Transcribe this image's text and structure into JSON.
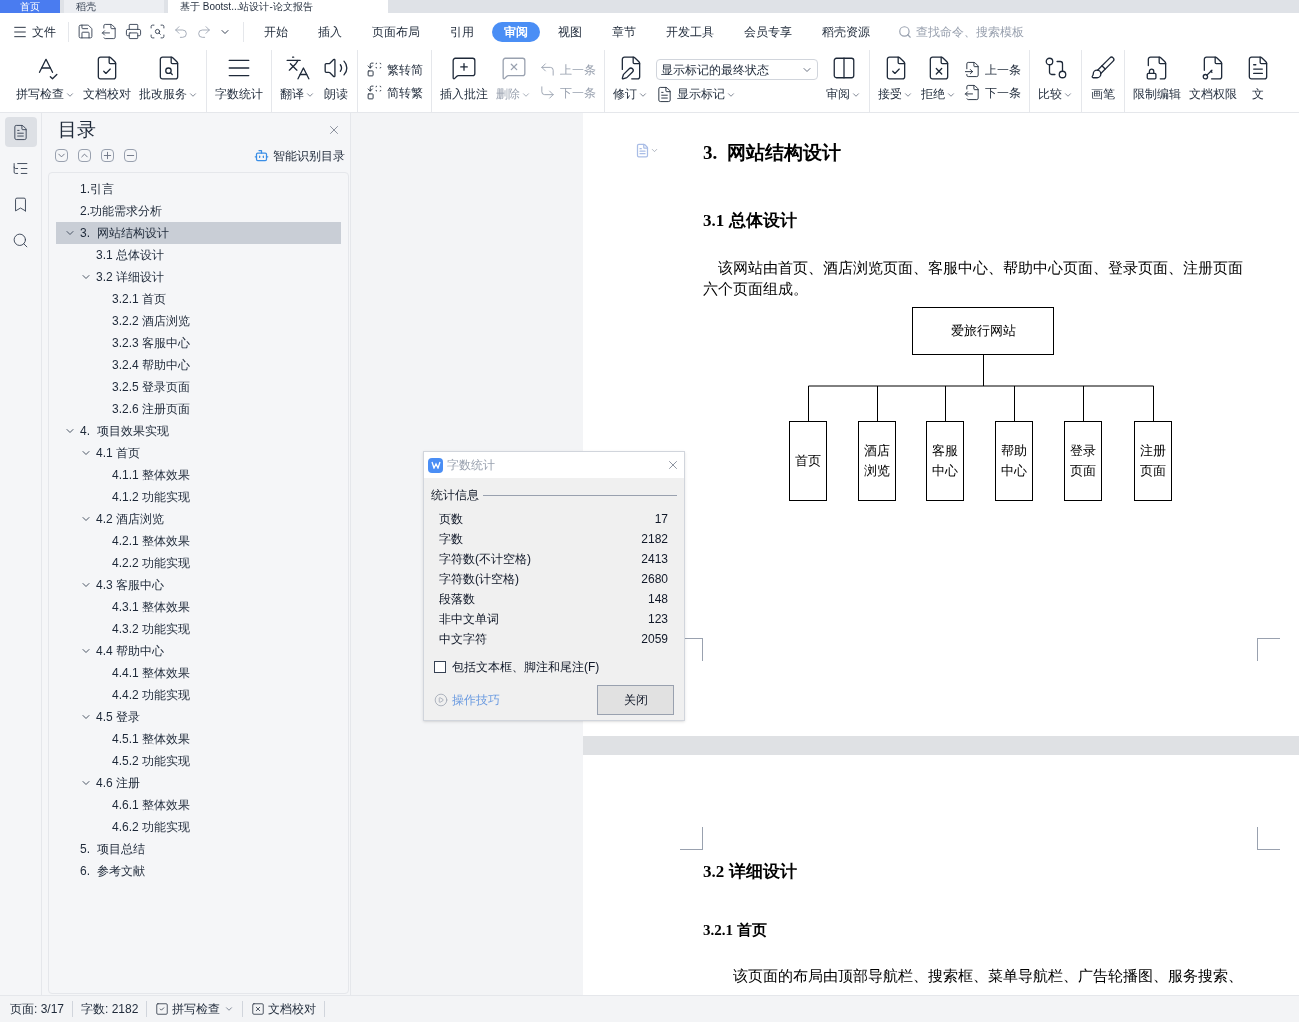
{
  "tab_strip": [
    {
      "label": "首页",
      "selected": false
    },
    {
      "label": "稻壳",
      "selected": false
    },
    {
      "label": "基于 Bootst...站设计-论文报告",
      "selected": true
    }
  ],
  "menu": {
    "file": "文件",
    "tabs": [
      {
        "label": "开始",
        "selected": false
      },
      {
        "label": "插入",
        "selected": false
      },
      {
        "label": "页面布局",
        "selected": false
      },
      {
        "label": "引用",
        "selected": false
      },
      {
        "label": "审阅",
        "selected": true
      },
      {
        "label": "视图",
        "selected": false
      },
      {
        "label": "章节",
        "selected": false
      },
      {
        "label": "开发工具",
        "selected": false
      },
      {
        "label": "会员专享",
        "selected": false
      },
      {
        "label": "稻壳资源",
        "selected": false
      }
    ],
    "search": {
      "placeholder": "查找命令、搜索模板"
    }
  },
  "ribbon": [
    {
      "items": [
        {
          "kind": "large",
          "label": "拼写检查",
          "dropdown": true,
          "disabled": false
        },
        {
          "kind": "large",
          "label": "文档校对",
          "dropdown": false,
          "disabled": false
        },
        {
          "kind": "large",
          "label": "批改服务",
          "dropdown": true,
          "disabled": false
        }
      ]
    },
    {
      "items": [
        {
          "kind": "large",
          "label": "字数统计",
          "dropdown": false,
          "disabled": false
        }
      ]
    },
    {
      "items": [
        {
          "kind": "large",
          "label": "翻译",
          "dropdown": true,
          "disabled": false
        },
        {
          "kind": "large",
          "label": "朗读",
          "dropdown": false,
          "disabled": false
        }
      ]
    },
    {
      "items": [
        {
          "kind": "stack",
          "rows": [
            {
              "kind": "button",
              "label": "繁转简",
              "dropdown": false,
              "disabled": false
            },
            {
              "kind": "button",
              "label": "简转繁",
              "dropdown": false,
              "disabled": false
            }
          ]
        }
      ]
    },
    {
      "items": [
        {
          "kind": "large",
          "label": "插入批注",
          "dropdown": false,
          "disabled": false
        },
        {
          "kind": "large",
          "label": "删除",
          "dropdown": true,
          "disabled": true
        },
        {
          "kind": "stack",
          "rows": [
            {
              "kind": "button",
              "label": "上一条",
              "dropdown": false,
              "disabled": true
            },
            {
              "kind": "button",
              "label": "下一条",
              "dropdown": false,
              "disabled": true
            }
          ]
        }
      ]
    },
    {
      "items": [
        {
          "kind": "large",
          "label": "修订",
          "dropdown": true,
          "disabled": false
        },
        {
          "kind": "stack",
          "rows": [
            {
              "kind": "select",
              "value": "显示标记的最终状态"
            },
            {
              "kind": "button",
              "label": "显示标记",
              "dropdown": true,
              "disabled": false
            }
          ]
        },
        {
          "kind": "large",
          "label": "审阅",
          "dropdown": true,
          "disabled": false
        }
      ]
    },
    {
      "items": [
        {
          "kind": "large",
          "label": "接受",
          "dropdown": true,
          "disabled": false
        },
        {
          "kind": "large",
          "label": "拒绝",
          "dropdown": true,
          "disabled": false
        },
        {
          "kind": "stack",
          "rows": [
            {
              "kind": "button",
              "label": "上一条",
              "dropdown": false,
              "disabled": false
            },
            {
              "kind": "button",
              "label": "下一条",
              "dropdown": false,
              "disabled": false
            }
          ]
        }
      ]
    },
    {
      "items": [
        {
          "kind": "large",
          "label": "比较",
          "dropdown": true,
          "disabled": false
        }
      ]
    },
    {
      "items": [
        {
          "kind": "large",
          "label": "画笔",
          "dropdown": false,
          "disabled": false
        }
      ]
    },
    {
      "items": [
        {
          "kind": "large",
          "label": "限制编辑",
          "dropdown": false,
          "disabled": false
        },
        {
          "kind": "large",
          "label": "文档权限",
          "dropdown": false,
          "disabled": false
        },
        {
          "kind": "large",
          "label": "文",
          "dropdown": false,
          "disabled": false
        }
      ]
    }
  ],
  "rail": [
    {
      "selected": true
    },
    {
      "selected": false
    },
    {
      "selected": false
    },
    {
      "selected": false
    }
  ],
  "toc": {
    "title": "目录",
    "smart_button": "智能识别目录",
    "items": [
      {
        "label": "1.引言",
        "selected": false
      },
      {
        "label": "2.功能需求分析",
        "selected": false
      },
      {
        "label": "3.  网站结构设计",
        "selected": true,
        "expanded": true,
        "children": [
          {
            "label": "3.1 总体设计",
            "selected": false
          },
          {
            "label": "3.2 详细设计",
            "selected": false,
            "expanded": true,
            "children": [
              {
                "label": "3.2.1 首页",
                "selected": false
              },
              {
                "label": "3.2.2 酒店浏览",
                "selected": false
              },
              {
                "label": "3.2.3 客服中心",
                "selected": false
              },
              {
                "label": "3.2.4 帮助中心",
                "selected": false
              },
              {
                "label": "3.2.5 登录页面",
                "selected": false
              },
              {
                "label": "3.2.6 注册页面",
                "selected": false
              }
            ]
          }
        ]
      },
      {
        "label": "4.  项目效果实现",
        "selected": false,
        "expanded": true,
        "children": [
          {
            "label": "4.1 首页",
            "selected": false,
            "expanded": true,
            "children": [
              {
                "label": "4.1.1 整体效果",
                "selected": false
              },
              {
                "label": "4.1.2 功能实现",
                "selected": false
              }
            ]
          },
          {
            "label": "4.2 酒店浏览",
            "selected": false,
            "expanded": true,
            "children": [
              {
                "label": "4.2.1 整体效果",
                "selected": false
              },
              {
                "label": "4.2.2 功能实现",
                "selected": false
              }
            ]
          },
          {
            "label": "4.3 客服中心",
            "selected": false,
            "expanded": true,
            "children": [
              {
                "label": "4.3.1 整体效果",
                "selected": false
              },
              {
                "label": "4.3.2 功能实现",
                "selected": false
              }
            ]
          },
          {
            "label": "4.4 帮助中心",
            "selected": false,
            "expanded": true,
            "children": [
              {
                "label": "4.4.1 整体效果",
                "selected": false
              },
              {
                "label": "4.4.2 功能实现",
                "selected": false
              }
            ]
          },
          {
            "label": "4.5 登录",
            "selected": false,
            "expanded": true,
            "children": [
              {
                "label": "4.5.1 整体效果",
                "selected": false
              },
              {
                "label": "4.5.2 功能实现",
                "selected": false
              }
            ]
          },
          {
            "label": "4.6 注册",
            "selected": false,
            "expanded": true,
            "children": [
              {
                "label": "4.6.1 整体效果",
                "selected": false
              },
              {
                "label": "4.6.2 功能实现",
                "selected": false
              }
            ]
          }
        ]
      },
      {
        "label": "5.  项目总结",
        "selected": false
      },
      {
        "label": "6.  参考文献",
        "selected": false
      }
    ]
  },
  "document": {
    "page_1": {
      "heading": "3.  网站结构设计",
      "subheading": "3.1 总体设计",
      "paragraph": "该网站由首页、酒店浏览页面、客服中心、帮助中心页面、登录页面、注册页面六个页面组成。",
      "org_chart": {
        "root": "爱旅行网站",
        "children": [
          "首页",
          "酒店浏览",
          "客服中心",
          "帮助中心",
          "登录页面",
          "注册页面"
        ]
      }
    },
    "page_2": {
      "heading": "3.2 详细设计",
      "subheading": "3.2.1 首页",
      "paragraph": "该页面的布局由顶部导航栏、搜索框、菜单导航栏、广告轮播图、服务搜索、"
    }
  },
  "dialog": {
    "title": "字数统计",
    "section": "统计信息",
    "rows": [
      {
        "label": "页数",
        "value": "17"
      },
      {
        "label": "字数",
        "value": "2182"
      },
      {
        "label": "字符数(不计空格)",
        "value": "2413"
      },
      {
        "label": "字符数(计空格)",
        "value": "2680"
      },
      {
        "label": "段落数",
        "value": "148"
      },
      {
        "label": "非中文单词",
        "value": "123"
      },
      {
        "label": "中文字符",
        "value": "2059"
      }
    ],
    "checkbox": {
      "label": "包括文本框、脚注和尾注(F)",
      "checked": false
    },
    "tips_link": "操作技巧",
    "close_button": "关闭"
  },
  "status_bar": {
    "page": "页面: 3/17",
    "words": "字数: 2182",
    "spell_check": "拼写检查",
    "proofread": "文档校对"
  }
}
